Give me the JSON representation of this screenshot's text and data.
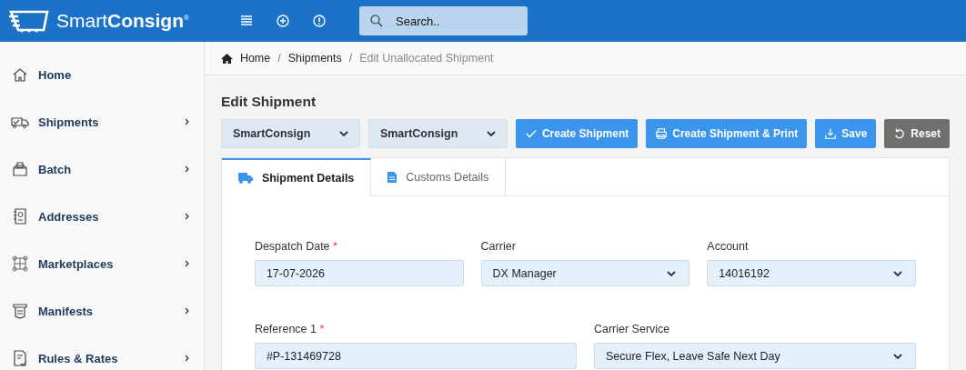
{
  "header": {
    "logo": "Smart**Consign**$^{®}$",
    "search": {
      "placeholder": "Search.."
    }
  },
  "sidebar": {
    "items": [
      {
        "label": "Home",
        "expandable": false
      },
      {
        "label": "Shipments",
        "expandable": true
      },
      {
        "label": "Batch",
        "expandable": true
      },
      {
        "label": "Addresses",
        "expandable": true
      },
      {
        "label": "Marketplaces",
        "expandable": true
      },
      {
        "label": "Manifests",
        "expandable": true
      },
      {
        "label": "Rules & Rates",
        "expandable": true
      }
    ]
  },
  "breadcrumb": [
    {
      "label": "Home",
      "current": false
    },
    {
      "separator": "/",
      "label": "Shipments",
      "current": false
    },
    {
      "separator": "/",
      "label": "Edit Unallocated Shipment",
      "current": true
    }
  ],
  "page_title": "Edit Shipment",
  "toolbar": {
    "selects": [
      {
        "value": "SmartConsign"
      },
      {
        "value": "SmartConsign"
      }
    ],
    "buttons": [
      {
        "label": "Create Shipment",
        "kind": "primary"
      },
      {
        "label": "Create Shipment & Print",
        "kind": "primary"
      },
      {
        "label": "Save",
        "kind": "primary"
      },
      {
        "label": "Reset",
        "kind": "secondary"
      }
    ]
  },
  "tabs": [
    {
      "label": "Shipment Details",
      "selected": true
    },
    {
      "label": "Customs Details",
      "selected": false
    }
  ],
  "form_rows": [
    [
      {
        "label": "Despatch Date",
        "required_mark": "*",
        "kind": "text",
        "value": "17-07-2026"
      },
      {
        "label": "Carrier",
        "kind": "select",
        "value": "DX Manager"
      },
      {
        "label": "Account",
        "kind": "select",
        "value": "14016192"
      }
    ],
    [
      {
        "label": "Reference 1",
        "required_mark": "*",
        "kind": "text",
        "value": "#P-131469728"
      },
      {
        "label": "Carrier Service",
        "kind": "select",
        "value": "Secure Flex, Leave Safe Next Day"
      }
    ]
  ]
}
